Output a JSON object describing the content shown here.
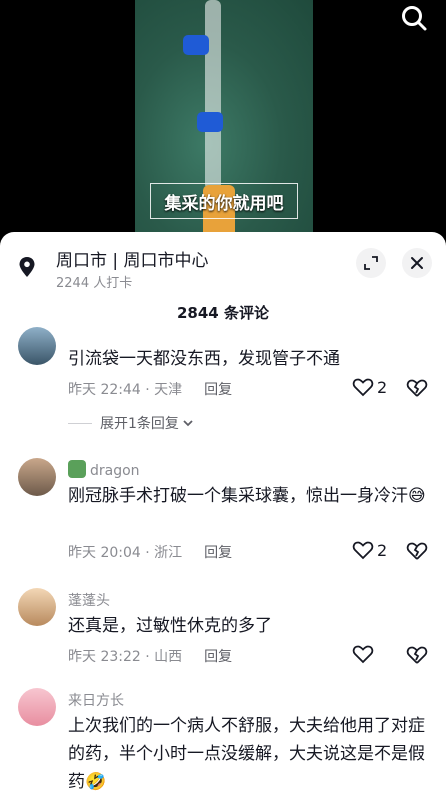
{
  "video": {
    "caption": "集采的你就用吧"
  },
  "location": {
    "title": "周口市 | 周口市中心",
    "checkins": "2244 人打卡"
  },
  "comments_header": {
    "count": "2844 条评论"
  },
  "comments": [
    {
      "user": "",
      "text": "引流袋一天都没东西，发现管子不通",
      "time": "昨天 22:44 · 天津",
      "reply": "回复",
      "likes": "2",
      "expand": "展开1条回复"
    },
    {
      "user": "dragon",
      "text": "刚冠脉手术打破一个集采球囊，惊出一身冷汗😅",
      "time": "昨天 20:04 · 浙江",
      "reply": "回复",
      "likes": "2"
    },
    {
      "user": "蓬蓬头",
      "text": "还真是，过敏性休克的多了",
      "time": "昨天 23:22 · 山西",
      "reply": "回复",
      "likes": ""
    },
    {
      "user": "来日方长",
      "text": "上次我们的一个病人不舒服，大夫给他用了对症的药，半个小时一点没缓解，大夫说这是不是假药🤣"
    }
  ],
  "icons": {
    "search": "search-icon",
    "pin": "location-pin-icon",
    "collapse": "collapse-icon",
    "close": "close-icon",
    "heart": "heart-icon",
    "dislike": "broken-heart-icon",
    "chevron": "chevron-down-icon"
  }
}
